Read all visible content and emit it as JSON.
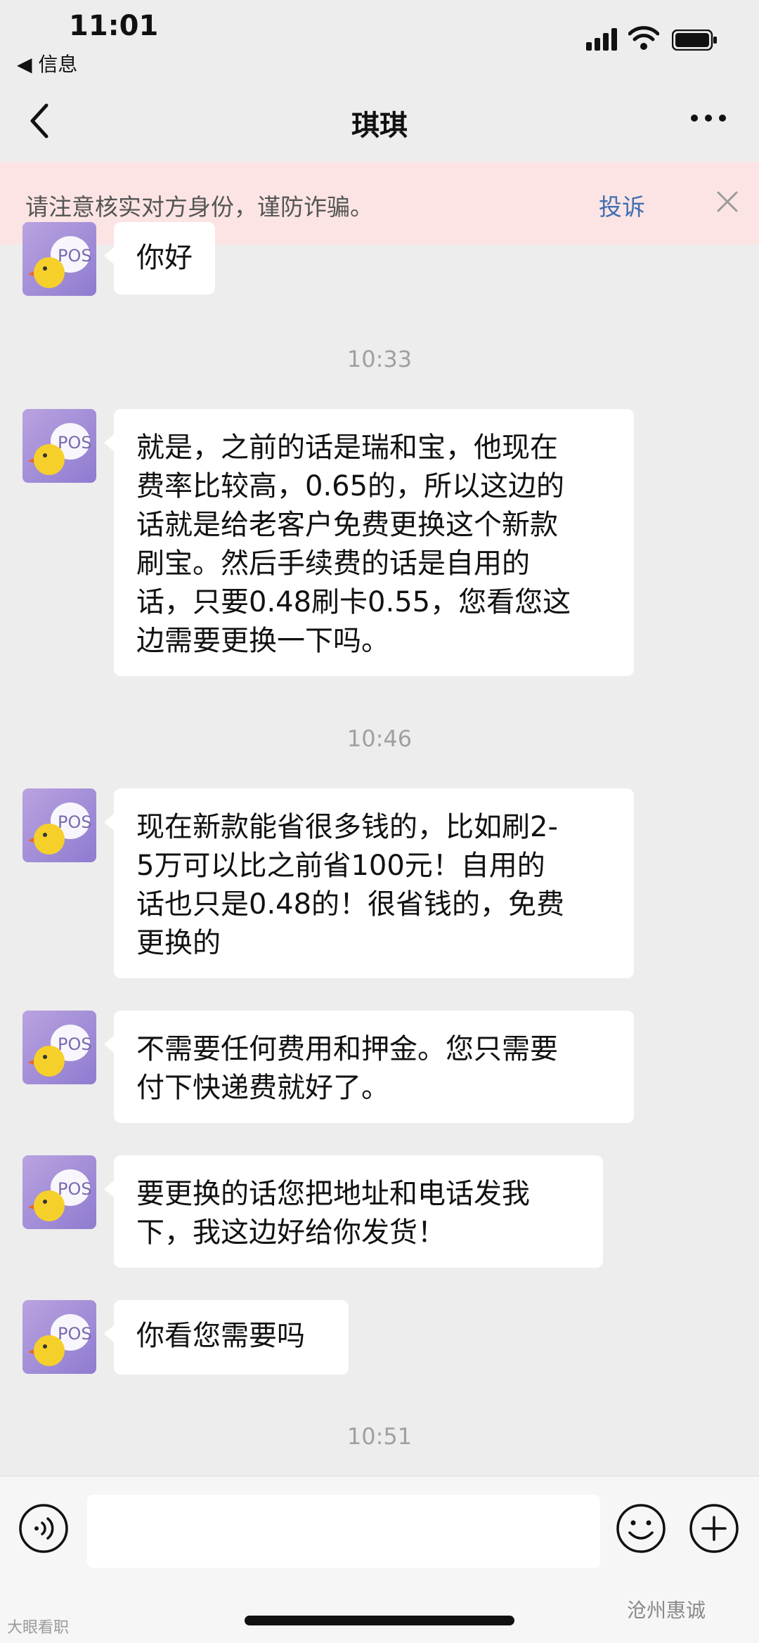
{
  "status_bar": {
    "time": "11:01",
    "back_app": "◀ 信息"
  },
  "nav": {
    "title": "琪琪"
  },
  "warning": {
    "text": "请注意核实对方身份，谨防诈骗。",
    "report_label": "投诉"
  },
  "avatar": {
    "label": "POS"
  },
  "messages": [
    {
      "type": "text",
      "lines": [
        "你好"
      ]
    },
    {
      "type": "time",
      "text": "10:33"
    },
    {
      "type": "text",
      "lines": [
        "就是，之前的话是瑞和宝，他现在",
        "费率比较高，0.65的，所以这边的",
        "话就是给老客户免费更换这个新款",
        "刷宝。然后手续费的话是自用的",
        "话，只要0.48刷卡0.55，您看您这",
        "边需要更换一下吗。"
      ]
    },
    {
      "type": "time",
      "text": "10:46"
    },
    {
      "type": "text",
      "lines": [
        "现在新款能省很多钱的，比如刷2-",
        "5万可以比之前省100元！自用的",
        "话也只是0.48的！很省钱的，免费",
        "更换的"
      ]
    },
    {
      "type": "text",
      "lines": [
        "不需要任何费用和押金。您只需要",
        "付下快递费就好了。"
      ]
    },
    {
      "type": "text",
      "lines": [
        "要更换的话您把地址和电话发我",
        "下，我这边好给你发货！"
      ]
    },
    {
      "type": "text",
      "lines": [
        "你看您需要吗"
      ]
    },
    {
      "type": "time",
      "text": "10:51"
    }
  ],
  "watermarks": {
    "left": "大眼看职",
    "right": "沧州惠诚"
  },
  "colors": {
    "background": "#ededed",
    "warning_bg": "#fbe4e3",
    "link": "#3f6fb3",
    "bubble": "#ffffff"
  }
}
